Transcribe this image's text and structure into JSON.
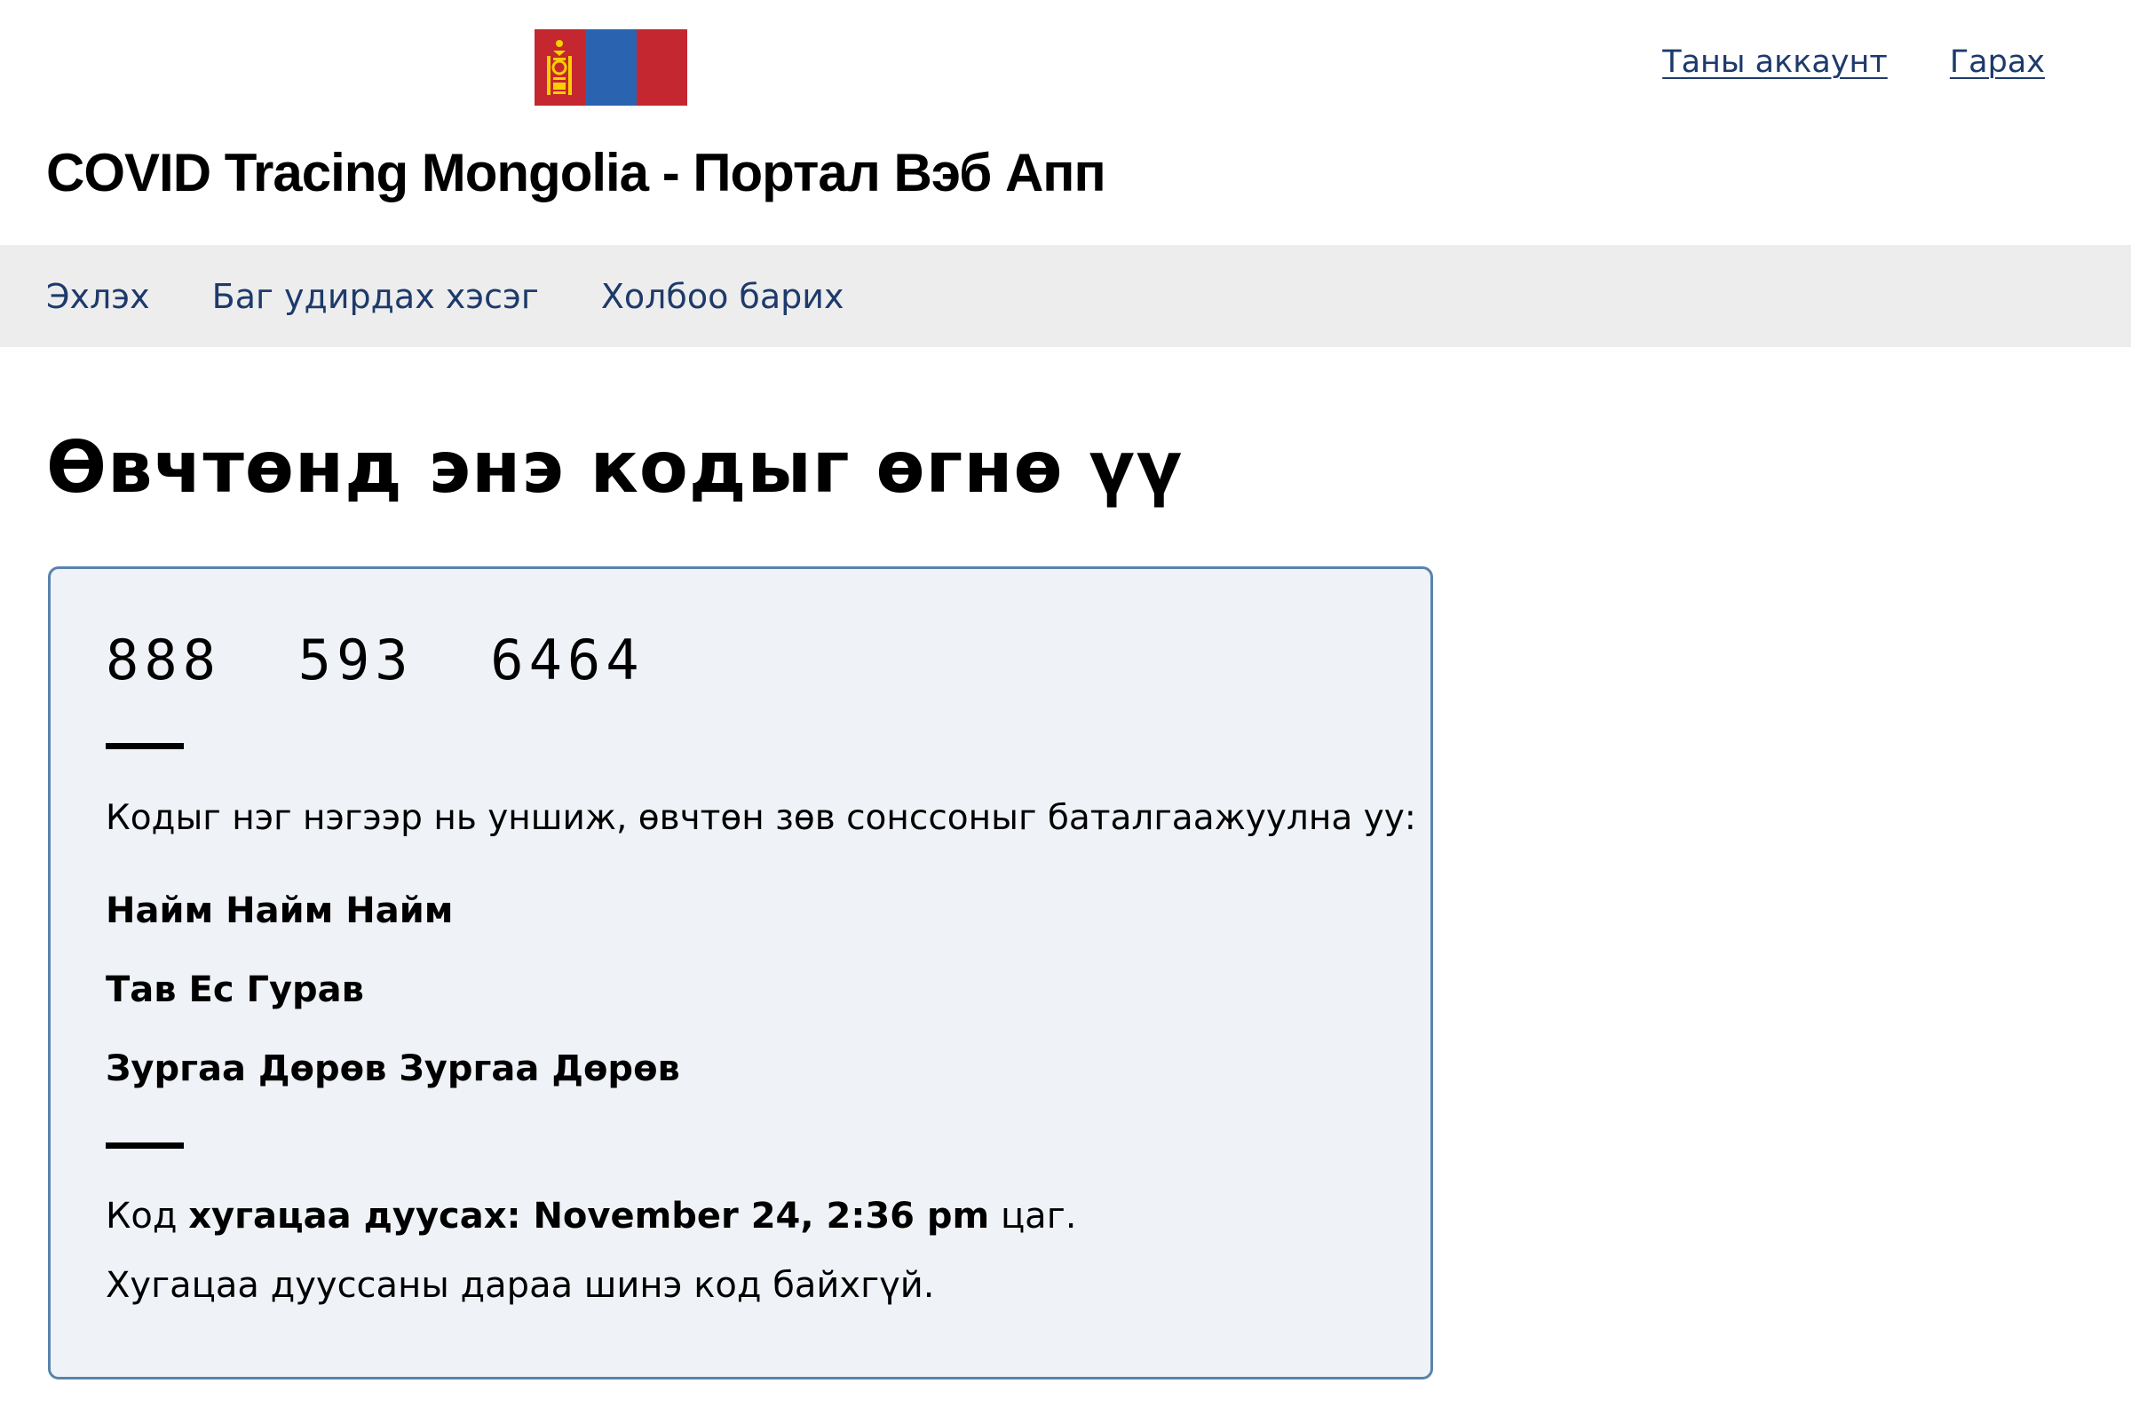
{
  "header": {
    "flag_colors": [
      "#c4272f",
      "#2a64b0",
      "#c4272f"
    ],
    "emblem_color": "#f9cf02",
    "account_label": "Таны аккаунт",
    "logout_label": "Гарах",
    "site_title": "COVID Tracing Mongolia - Портал Вэб Апп"
  },
  "nav": {
    "items": [
      {
        "label": "Эхлэх"
      },
      {
        "label": "Баг удирдах хэсэг"
      },
      {
        "label": "Холбоо барих"
      }
    ]
  },
  "main": {
    "heading": "Өвчтөнд энэ кодыг өгнө үү",
    "code": "888  593  6464",
    "instruction": "Кодыг нэг нэгээр нь уншиж, өвчтөн зөв сонссоныг баталгаажуулна уу:",
    "spoken_words": [
      "Найм Найм Найм",
      "Тав Ес Гурав",
      "Зургаа Дөрөв Зургаа Дөрөв"
    ],
    "expiry_prefix": "Код ",
    "expiry_bold": "хугацаа дуусах: November 24, 2:36 pm",
    "expiry_suffix": " цаг.",
    "note": "Хугацаа дууссаны дараа шинэ код байхгүй."
  },
  "colors": {
    "link": "#1d3a6b",
    "nav_bg": "#ededed",
    "card_bg": "#eff2f7",
    "card_border": "#5983ad"
  }
}
